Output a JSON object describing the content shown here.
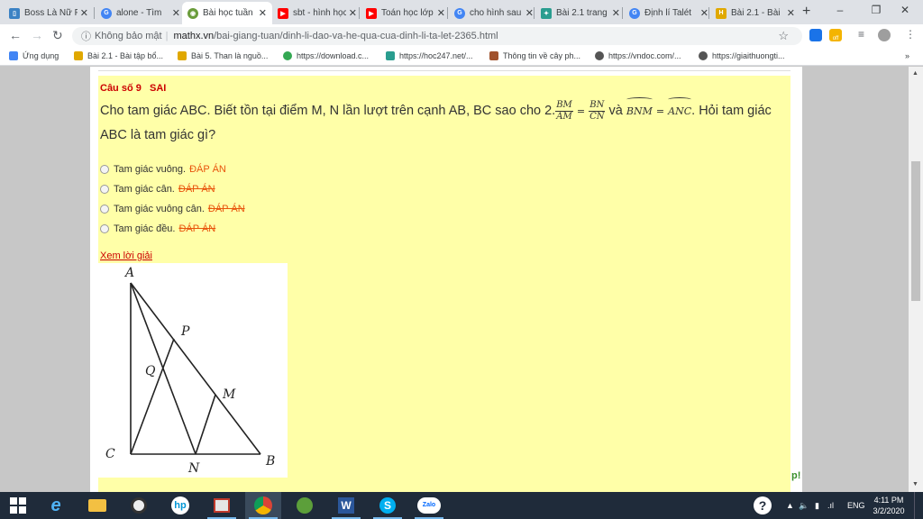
{
  "tabs": [
    {
      "title": "Boss Là Nữ Phụ",
      "icon": "book-icon",
      "color": "#3b82c4"
    },
    {
      "title": "alone - Tìm",
      "icon": "google-icon",
      "color": "#4285f4"
    },
    {
      "title": "Bài học tuần",
      "icon": "owl-icon",
      "color": "#6a9c3b"
    },
    {
      "title": "sbt - hình học",
      "icon": "youtube-icon",
      "color": "#ff0000"
    },
    {
      "title": "Toán học lớp",
      "icon": "youtube-icon",
      "color": "#ff0000"
    },
    {
      "title": "cho hình sau",
      "icon": "google-icon",
      "color": "#4285f4"
    },
    {
      "title": "Bài 2.1 trang",
      "icon": "hoc247-icon",
      "color": "#2a9d8f"
    },
    {
      "title": "Định lí Talét",
      "icon": "google-icon",
      "color": "#4285f4"
    },
    {
      "title": "Bài 2.1 - Bài",
      "icon": "h-icon",
      "color": "#e0a800"
    }
  ],
  "window": {
    "minimize": "–",
    "maximize": "❐",
    "close": "✕",
    "new_tab": "+"
  },
  "toolbar": {
    "security_label": "Không bảo mật",
    "url_host": "mathx.vn",
    "url_path": "/bai-giang-tuan/dinh-li-dao-va-he-qua-cua-dinh-li-ta-let-2365.html",
    "ext_badge": "off"
  },
  "bookmarks": [
    {
      "label": "Ứng dụng",
      "icon": "apps-icon",
      "color": "#4285f4"
    },
    {
      "label": "Bài 2.1 - Bài tập bổ...",
      "icon": "h-icon",
      "color": "#e0a800"
    },
    {
      "label": "Bài 5. Than là nguồ...",
      "icon": "h-icon",
      "color": "#e0a800"
    },
    {
      "label": "https://download.c...",
      "icon": "chrome-icon",
      "color": "#34a853"
    },
    {
      "label": "https://hoc247.net/...",
      "icon": "hoc247-icon",
      "color": "#2a9d8f"
    },
    {
      "label": "Thông tin về cây ph...",
      "icon": "leaf-icon",
      "color": "#a0522d"
    },
    {
      "label": "https://vndoc.com/...",
      "icon": "globe-icon",
      "color": "#555555"
    },
    {
      "label": "https://giaithuongti...",
      "icon": "globe-icon",
      "color": "#555555"
    }
  ],
  "question": {
    "number_label": "Câu số 9",
    "status": "SAI",
    "text_before": "Cho tam giác ABC. Biết tồn tại điểm M, N  lần lượt trên cạnh AB, BC sao cho 2.",
    "frac1_num": "BM",
    "frac1_den": "AM",
    "equals": "=",
    "frac2_num": "BN",
    "frac2_den": "CN",
    "and_word": "và",
    "angle1": "BNM",
    "angle2": "ANC",
    "text_after": ". Hỏi tam giác ABC là tam giác gì?",
    "options": [
      {
        "label": "Tam giác vuông.",
        "answer": "ĐÁP ÁN",
        "struck": false
      },
      {
        "label": "Tam giác cân.",
        "answer": "ĐÁP ÁN",
        "struck": true
      },
      {
        "label": "Tam giác vuông cân.",
        "answer": "ĐÁP ÁN",
        "struck": true
      },
      {
        "label": "Tam giác đều.",
        "answer": "ĐÁP ÁN",
        "struck": true
      }
    ],
    "solution_link": "Xem lời giải",
    "figure_labels": {
      "A": "A",
      "P": "P",
      "Q": "Q",
      "M": "M",
      "C": "C",
      "N": "N",
      "B": "B"
    }
  },
  "peek_text": "p!",
  "taskbar": {
    "apps": [
      "start-icon",
      "ie-icon",
      "explorer-icon",
      "media-icon",
      "hp-icon",
      "paint-icon",
      "chrome-icon",
      "greenshot-icon",
      "word-icon",
      "skype-icon",
      "zalo-icon"
    ],
    "zalo_label": "Zalo",
    "lang": "ENG",
    "time": "4:11 PM",
    "date": "3/2/2020",
    "help": "?"
  },
  "colors": {
    "card_bg": "#ffffa8",
    "status_red": "#cc0000",
    "answer_orange": "#e8540c"
  }
}
